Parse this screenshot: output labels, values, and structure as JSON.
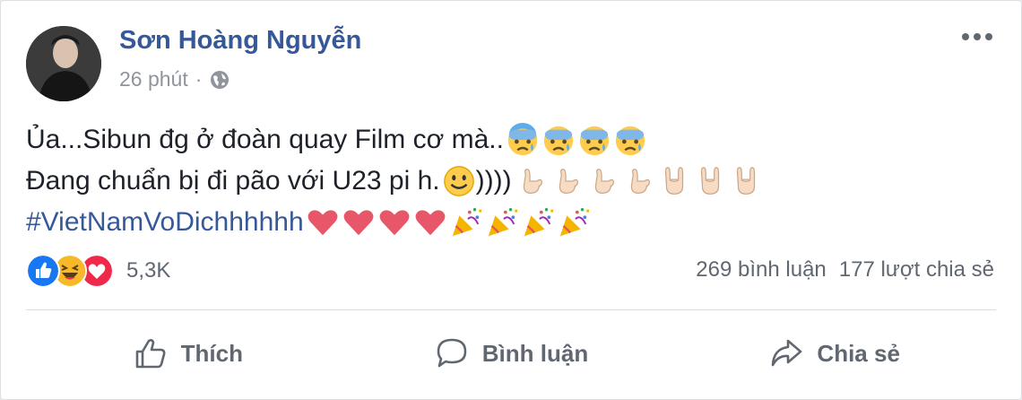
{
  "post": {
    "author": "Sơn Hoàng Nguyễn",
    "time": "26 phút",
    "separator": "·",
    "privacy_icon": "globe-icon",
    "text_line1": "Ủa...Sibun đg ở đoàn quay Film cơ mà..",
    "text_line2a": "Đang chuẩn bị đi pão với U23 pi h.",
    "text_line2b": "))))",
    "hashtag": "#VietNamVoDichhhhhh"
  },
  "reactions": {
    "icons": [
      "like-icon",
      "haha-icon",
      "love-icon"
    ],
    "count": "5,3K",
    "comments": "269 bình luận",
    "shares": "177 lượt chia sẻ"
  },
  "actions": {
    "like_label": "Thích",
    "comment_label": "Bình luận",
    "share_label": "Chia sẻ"
  },
  "colors": {
    "link": "#365899",
    "like": "#1877f2",
    "love": "#f0284a",
    "haha": "#f7b928"
  }
}
